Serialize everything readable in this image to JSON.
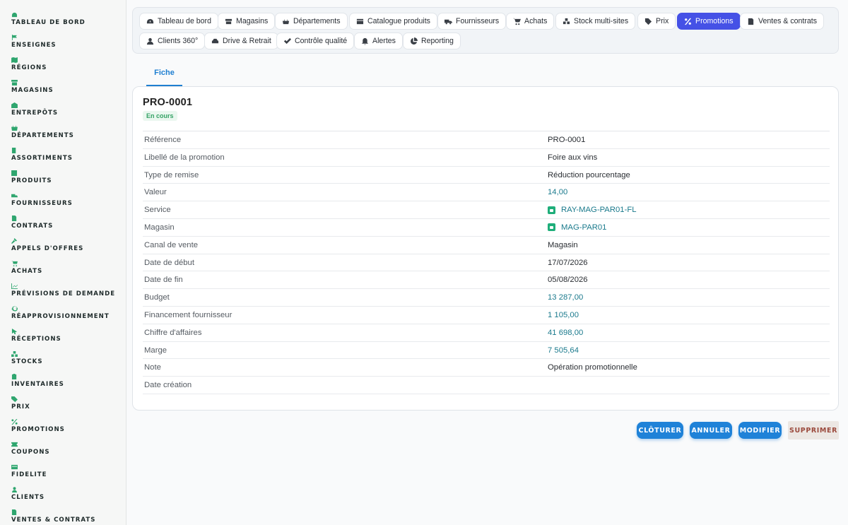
{
  "sidebar": {
    "items": [
      {
        "label": "TABLEAU DE BORD",
        "icon": "dashboard-icon"
      },
      {
        "label": "ENSEIGNES",
        "icon": "flag-icon"
      },
      {
        "label": "RÉGIONS",
        "icon": "map-icon"
      },
      {
        "label": "MAGASINS",
        "icon": "store-icon"
      },
      {
        "label": "ENTREPÔTS",
        "icon": "warehouse-icon"
      },
      {
        "label": "DÉPARTEMENTS",
        "icon": "basket-icon"
      },
      {
        "label": "ASSORTIMENTS",
        "icon": "list-icon"
      },
      {
        "label": "PRODUITS",
        "icon": "box-icon"
      },
      {
        "label": "FOURNISSEURS",
        "icon": "truck-icon"
      },
      {
        "label": "CONTRATS",
        "icon": "document-icon"
      },
      {
        "label": "APPELS D'OFFRES",
        "icon": "gavel-icon"
      },
      {
        "label": "ACHATS",
        "icon": "cart-icon"
      },
      {
        "label": "PRÉVISIONS DE DEMANDE",
        "icon": "chart-icon"
      },
      {
        "label": "RÉAPPROVISIONNEMENT",
        "icon": "refresh-icon"
      },
      {
        "label": "RÉCEPTIONS",
        "icon": "receipt-icon"
      },
      {
        "label": "STOCKS",
        "icon": "stock-icon"
      },
      {
        "label": "INVENTAIRES",
        "icon": "clipboard-icon"
      },
      {
        "label": "PRIX",
        "icon": "tag-icon"
      },
      {
        "label": "PROMOTIONS",
        "icon": "percent-icon"
      },
      {
        "label": "COUPONS",
        "icon": "ticket-icon"
      },
      {
        "label": "FIDELITE",
        "icon": "card-icon"
      },
      {
        "label": "CLIENTS",
        "icon": "user-icon"
      },
      {
        "label": "VENTES & CONTRATS",
        "icon": "document-icon"
      }
    ]
  },
  "nav": {
    "row1": [
      {
        "label": "Tableau de bord",
        "icon": "gauge-icon"
      },
      {
        "label": "Magasins",
        "icon": "store-icon"
      },
      {
        "label": "Départements",
        "icon": "basket-icon"
      },
      {
        "label": "Catalogue produits",
        "icon": "catalog-icon"
      },
      {
        "label": "Fournisseurs",
        "icon": "truck-icon"
      },
      {
        "label": "Achats",
        "icon": "cart-icon"
      },
      {
        "label": "Stock multi-sites",
        "icon": "stock-icon"
      },
      {
        "label": "Prix",
        "icon": "tag-icon"
      },
      {
        "label": "Promotions",
        "icon": "percent-icon",
        "active": true
      },
      {
        "label": "Ventes & contrats",
        "icon": "document-icon"
      }
    ],
    "row2": [
      {
        "label": "Clients 360°",
        "icon": "user-icon"
      },
      {
        "label": "Drive & Retrait",
        "icon": "car-icon"
      },
      {
        "label": "Contrôle qualité",
        "icon": "check-icon"
      },
      {
        "label": "Alertes",
        "icon": "bell-icon"
      },
      {
        "label": "Reporting",
        "icon": "pie-icon"
      }
    ]
  },
  "tabs": {
    "fiche": "Fiche"
  },
  "record": {
    "title": "PRO-0001",
    "status": "En cours",
    "fields": [
      {
        "label": "Référence",
        "value": "PRO-0001",
        "kind": "text"
      },
      {
        "label": "Libellé de la promotion",
        "value": "Foire aux vins",
        "kind": "text"
      },
      {
        "label": "Type de remise",
        "value": "Réduction pourcentage",
        "kind": "text"
      },
      {
        "label": "Valeur",
        "value": "14,00",
        "kind": "num"
      },
      {
        "label": "Service",
        "value": "RAY-MAG-PAR01-FL",
        "kind": "link"
      },
      {
        "label": "Magasin",
        "value": "MAG-PAR01",
        "kind": "link"
      },
      {
        "label": "Canal de vente",
        "value": "Magasin",
        "kind": "text"
      },
      {
        "label": "Date de début",
        "value": "17/07/2026",
        "kind": "text"
      },
      {
        "label": "Date de fin",
        "value": "05/08/2026",
        "kind": "text"
      },
      {
        "label": "Budget",
        "value": "13 287,00",
        "kind": "num"
      },
      {
        "label": "Financement fournisseur",
        "value": "1 105,00",
        "kind": "num"
      },
      {
        "label": "Chiffre d'affaires",
        "value": "41 698,00",
        "kind": "num"
      },
      {
        "label": "Marge",
        "value": "7 505,64",
        "kind": "num"
      },
      {
        "label": "Note",
        "value": "Opération promotionnelle",
        "kind": "text"
      },
      {
        "label": "Date création",
        "value": "",
        "kind": "text"
      }
    ]
  },
  "actions": {
    "cloturer": "CLÔTURER",
    "annuler": "ANNULER",
    "modifier": "MODIFIER",
    "supprimer": "SUPPRIMER"
  },
  "colors": {
    "accent": "#4551e6",
    "primary_button": "#1f82d8",
    "sidebar_icon": "#2fa66f",
    "status_green": "#33a264"
  }
}
